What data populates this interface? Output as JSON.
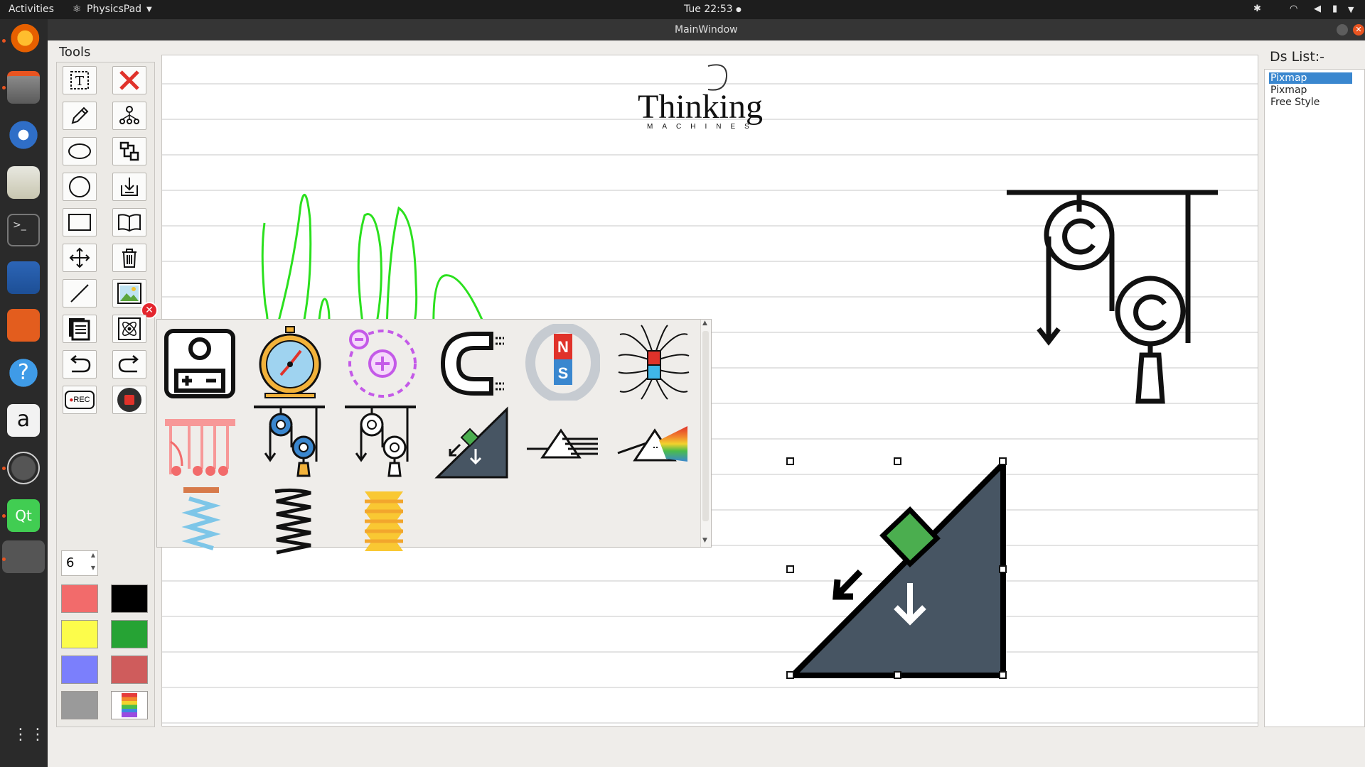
{
  "topbar": {
    "activities": "Activities",
    "app": "PhysicsPad",
    "clock": "Tue 22:53"
  },
  "window": {
    "title": "MainWindow"
  },
  "tools": {
    "title": "Tools",
    "items": [
      {
        "name": "text-tool",
        "icon": "text-box-icon"
      },
      {
        "name": "clear-tool",
        "icon": "red-x-icon"
      },
      {
        "name": "pencil-tool",
        "icon": "pencil-icon"
      },
      {
        "name": "hierarchy-tool",
        "icon": "tree-nodes-icon"
      },
      {
        "name": "ellipse-tool",
        "icon": "ellipse-icon"
      },
      {
        "name": "layout-tool",
        "icon": "layout-blocks-icon"
      },
      {
        "name": "circle-tool",
        "icon": "circle-icon"
      },
      {
        "name": "import-tool",
        "icon": "download-tray-icon"
      },
      {
        "name": "rectangle-tool",
        "icon": "rectangle-icon"
      },
      {
        "name": "book-tool",
        "icon": "open-book-icon"
      },
      {
        "name": "move-tool",
        "icon": "move-arrows-icon"
      },
      {
        "name": "delete-tool",
        "icon": "trash-icon"
      },
      {
        "name": "line-tool",
        "icon": "line-icon"
      },
      {
        "name": "image-tool",
        "icon": "image-icon"
      },
      {
        "name": "pages-tool",
        "icon": "pages-icon"
      },
      {
        "name": "atom-tool",
        "icon": "atom-icon"
      },
      {
        "name": "undo-tool",
        "icon": "undo-icon"
      },
      {
        "name": "redo-tool",
        "icon": "redo-icon"
      },
      {
        "name": "record-tool",
        "icon": "rec-icon",
        "label": "REC"
      },
      {
        "name": "stop-tool",
        "icon": "stop-icon"
      }
    ],
    "pen_size": "6",
    "colors": [
      "#f26b6b",
      "#000000",
      "#fcfc4b",
      "#26a334",
      "#7b7ffc",
      "#cf5c5c",
      "#9a9a9a",
      "rainbow"
    ]
  },
  "palette": {
    "items": [
      "battery-circuit-icon",
      "stopwatch-icon",
      "charges-orbit-icon",
      "horseshoe-magnet-icon",
      "bar-magnet-icon",
      "magnetic-field-icon",
      "newtons-cradle-icon",
      "pulley-color-icon",
      "pulley-outline-icon",
      "inclined-plane-icon",
      "prism-beam-icon",
      "prism-spectrum-icon",
      "spring-blue-icon",
      "spring-black-icon",
      "spring-yellow-icon"
    ]
  },
  "logo": {
    "word": "Thinking",
    "sub": "MACHINES"
  },
  "ds_list": {
    "title": "Ds List:-",
    "items": [
      "Pixmap",
      "Pixmap",
      "Free Style"
    ],
    "selected": 0
  },
  "accent": "#3a87cf"
}
